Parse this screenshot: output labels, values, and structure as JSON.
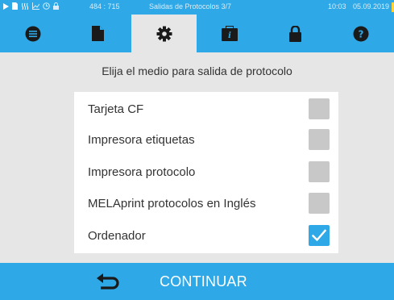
{
  "status_bar": {
    "coords": "484 : 715",
    "title": "Salidas de Protocolos 3/7",
    "time": "10:03",
    "date": "05.09.2019",
    "icons": [
      "play-icon",
      "document-icon",
      "steam-icon",
      "chart-icon",
      "clock-icon",
      "lock-icon"
    ]
  },
  "tabs": [
    {
      "icon": "list-icon",
      "active": false
    },
    {
      "icon": "file-icon",
      "active": false
    },
    {
      "icon": "gear-icon",
      "active": true
    },
    {
      "icon": "info-book-icon",
      "active": false
    },
    {
      "icon": "lock-icon",
      "active": false
    },
    {
      "icon": "help-icon",
      "active": false
    }
  ],
  "heading": "Elija el medio para salida de protocolo",
  "options": [
    {
      "label": "Tarjeta CF",
      "checked": false
    },
    {
      "label": "Impresora etiquetas",
      "checked": false
    },
    {
      "label": "Impresora protocolo",
      "checked": false
    },
    {
      "label": "MELAprint protocolos en Inglés",
      "checked": false
    },
    {
      "label": "Ordenador",
      "checked": true
    }
  ],
  "bottom_bar": {
    "back_icon": "back-arrow-icon",
    "continue_label": "CONTINUAR"
  },
  "colors": {
    "accent": "#2ea8e6",
    "background": "#e6e6e6",
    "checkbox_off": "#c8c8c8"
  }
}
